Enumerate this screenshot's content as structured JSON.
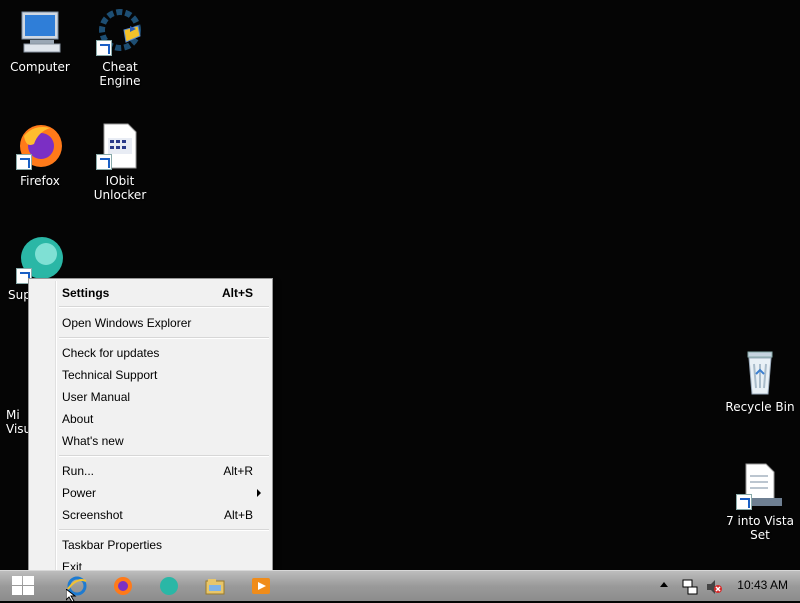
{
  "desktop": {
    "icons": [
      {
        "label": "Computer"
      },
      {
        "label": "Cheat Engine"
      },
      {
        "label": "Firefox"
      },
      {
        "label": "IObit Unlocker"
      },
      {
        "label": "Sup"
      },
      {
        "label": "Mi\nVisu"
      },
      {
        "label": "Recycle Bin"
      },
      {
        "label": "7 into Vista\nSet"
      }
    ]
  },
  "context_menu": {
    "items": [
      {
        "label": "Settings",
        "shortcut": "Alt+S"
      },
      {
        "label": "Open Windows Explorer",
        "shortcut": ""
      },
      {
        "label": "Check for updates",
        "shortcut": ""
      },
      {
        "label": "Technical Support",
        "shortcut": ""
      },
      {
        "label": "User Manual",
        "shortcut": ""
      },
      {
        "label": "About",
        "shortcut": ""
      },
      {
        "label": "What's new",
        "shortcut": ""
      },
      {
        "label": "Run...",
        "shortcut": "Alt+R"
      },
      {
        "label": "Power",
        "shortcut": ""
      },
      {
        "label": "Screenshot",
        "shortcut": "Alt+B"
      },
      {
        "label": "Taskbar Properties",
        "shortcut": ""
      },
      {
        "label": "Exit",
        "shortcut": ""
      }
    ]
  },
  "taskbar": {
    "clock": "10:43 AM",
    "pinned": [
      "internet-explorer-icon",
      "firefox-icon",
      "app-icon",
      "explorer-folder-icon",
      "media-player-icon"
    ],
    "tray": [
      "show-hidden-icons-icon",
      "network-icon",
      "volume-muted-icon"
    ]
  },
  "colors": {
    "desktop_bg": "#050505",
    "menu_bg": "#f1f1f1",
    "taskbar": "#9a9a9a"
  }
}
